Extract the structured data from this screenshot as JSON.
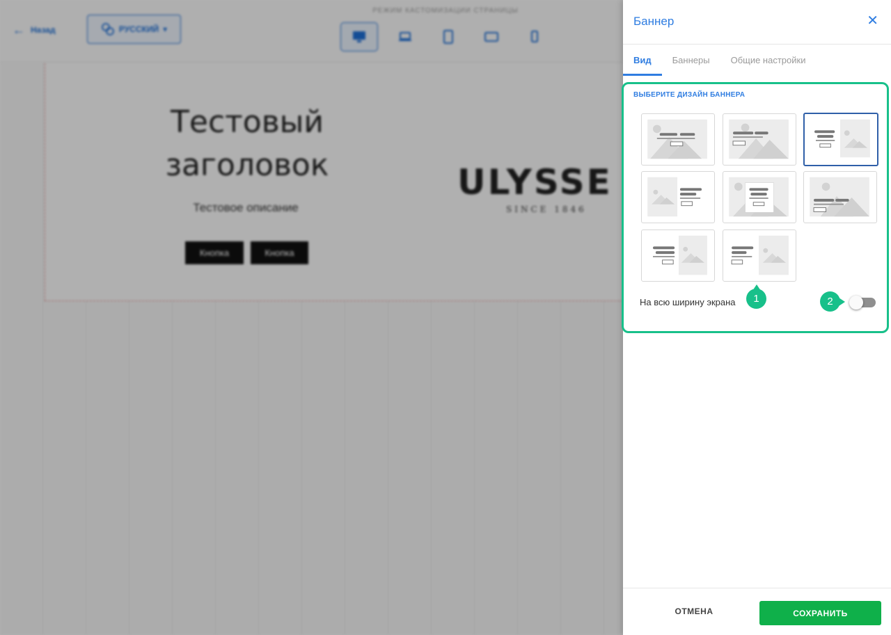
{
  "topbar": {
    "back_label": "Назад",
    "language_label": "РУССКИЙ",
    "mode_title": "РЕЖИМ КАСТОМИЗАЦИИ СТРАНИЦЫ",
    "devices": [
      "desktop-icon",
      "laptop-icon",
      "tablet-icon",
      "tablet-landscape-icon",
      "mobile-icon"
    ],
    "active_device": "desktop"
  },
  "preview": {
    "title": "Тестовый заголовок",
    "description": "Тестовое описание",
    "button1": "Кнопка",
    "button2": "Кнопка",
    "logo_text": "ULYSSE",
    "logo_subtext": "SINCE 1846"
  },
  "panel": {
    "title": "Баннер",
    "tabs": [
      {
        "label": "Вид",
        "active": true
      },
      {
        "label": "Баннеры",
        "active": false
      },
      {
        "label": "Общие настройки",
        "active": false
      }
    ],
    "design_label": "ВЫБЕРИТЕ ДИЗАЙН БАННЕРА",
    "designs": [
      {
        "id": 1,
        "layout": "image-full-text-center",
        "selected": false
      },
      {
        "id": 2,
        "layout": "image-full-text-left",
        "selected": false
      },
      {
        "id": 3,
        "layout": "text-left-image-right",
        "selected": true
      },
      {
        "id": 4,
        "layout": "image-left-text-right",
        "selected": false
      },
      {
        "id": 5,
        "layout": "image-full-card-center",
        "selected": false
      },
      {
        "id": 6,
        "layout": "image-full-text-bottom",
        "selected": false
      },
      {
        "id": 7,
        "layout": "text-left-image-right-wide",
        "selected": false
      },
      {
        "id": 8,
        "layout": "text-left-image-right-boxed",
        "selected": false
      }
    ],
    "fullwidth_label": "На всю ширину экрана",
    "fullwidth_enabled": false,
    "marker1": "1",
    "marker2": "2",
    "cancel_label": "ОТМЕНА",
    "save_label": "СОХРАНИТЬ"
  },
  "colors": {
    "accent": "#2f7de1",
    "highlight": "#18c08a",
    "save": "#0fb04a"
  }
}
